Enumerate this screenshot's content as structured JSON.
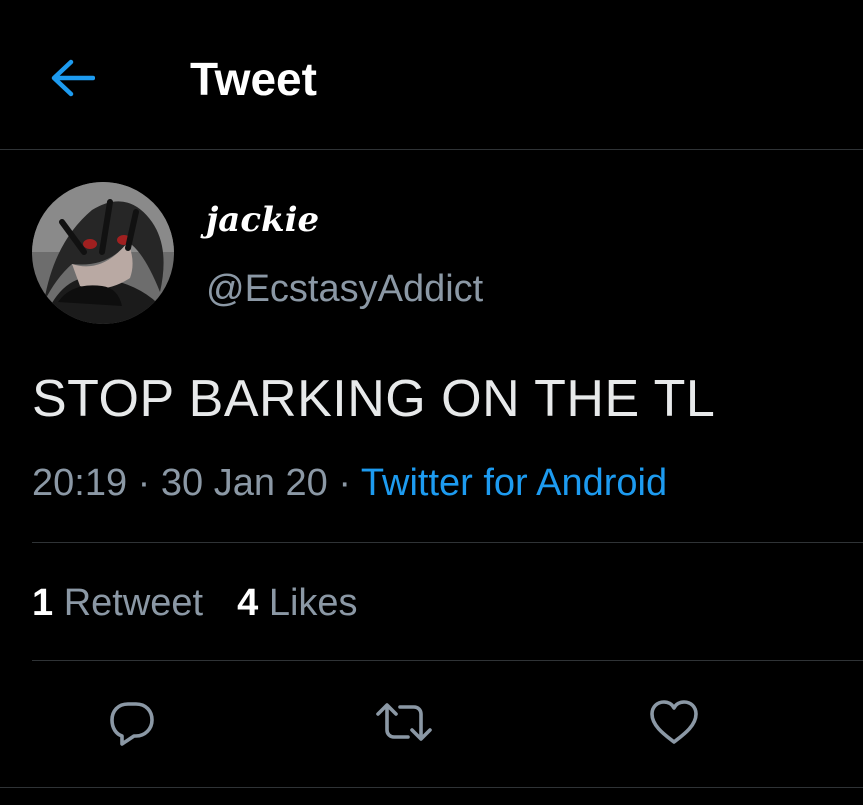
{
  "header": {
    "back_icon": "arrow-left-icon",
    "title": "Tweet"
  },
  "author": {
    "display_name": "jackie",
    "handle": "@EcstasyAddict",
    "avatar": "anime-character-avatar"
  },
  "tweet": {
    "text": "STOP BARKING ON THE TL",
    "time": "20:19",
    "separator": "·",
    "date": "30 Jan 20",
    "source": "Twitter for Android"
  },
  "stats": {
    "retweets_count": "1",
    "retweets_label": "Retweet",
    "likes_count": "4",
    "likes_label": "Likes"
  },
  "actions": {
    "reply_icon": "reply-icon",
    "retweet_icon": "retweet-icon",
    "like_icon": "heart-icon"
  },
  "colors": {
    "background": "#000000",
    "accent": "#1d9bf0",
    "muted_text": "#8b98a5",
    "divider": "#2f3336"
  }
}
